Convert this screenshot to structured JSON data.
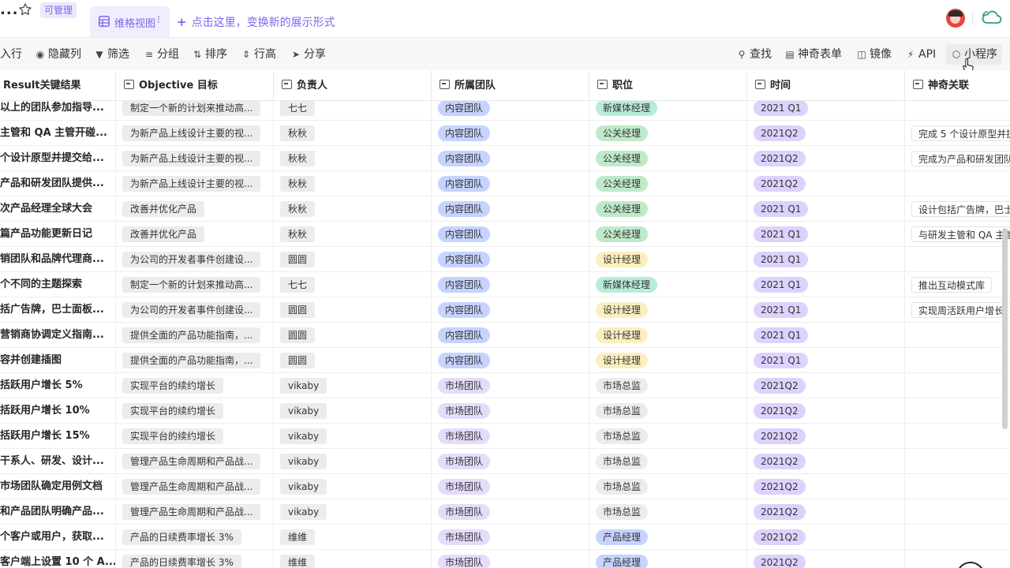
{
  "header": {
    "ellipsis": "...",
    "permission_badge": "可管理",
    "view_tab_label": "维格视图",
    "view_tab_more": "⁝",
    "add_view_plus": "+",
    "add_view_label": "点击这里，变换新的展示形式"
  },
  "toolbar": {
    "items": [
      {
        "label": "入行",
        "icon": ""
      },
      {
        "label": "隐藏列",
        "icon": "eye-icon"
      },
      {
        "label": "筛选",
        "icon": "filter-icon"
      },
      {
        "label": "分组",
        "icon": "group-icon"
      },
      {
        "label": "排序",
        "icon": "sort-icon"
      },
      {
        "label": "行高",
        "icon": "row-height-icon"
      },
      {
        "label": "分享",
        "icon": "share-icon"
      },
      {
        "label": "查找",
        "icon": "search-icon"
      },
      {
        "label": "神奇表单",
        "icon": "form-icon"
      },
      {
        "label": "镜像",
        "icon": "mirror-icon"
      },
      {
        "label": "API",
        "icon": "api-icon"
      },
      {
        "label": "小程序",
        "icon": "widget-icon"
      }
    ]
  },
  "columns": [
    {
      "label": "Result关键结果",
      "icon": "none"
    },
    {
      "label": "Objective 目标",
      "icon": "link-icon"
    },
    {
      "label": "负责人",
      "icon": "field-icon"
    },
    {
      "label": "所属团队",
      "icon": "field-icon"
    },
    {
      "label": "职位",
      "icon": "field-icon"
    },
    {
      "label": "时间",
      "icon": "field-icon"
    },
    {
      "label": "神奇关联",
      "icon": "link-icon"
    }
  ],
  "colors": {
    "accent": "#7b67ee",
    "team_inner": "#c6d3ff",
    "team_market": "#e5dcfb",
    "role_pr": "#bfeac9",
    "role_design": "#fbefbf",
    "role_media": "#b9ecd8",
    "role_market": "#ececec",
    "role_product": "#c6d3ff",
    "time": "#ddd2fd"
  },
  "rows": [
    {
      "kr": "以上的团队参加指导...",
      "objective": "制定一个新的计划来推动高...",
      "owner": "七七",
      "team": "内容团队",
      "team_c": "blue",
      "role": "新媒体经理",
      "role_c": "teal",
      "time": "2021 Q1",
      "link": "",
      "link2": ""
    },
    {
      "kr": "主管和 QA 主管开碰...",
      "objective": "为新产品上线设计主要的视...",
      "owner": "秋秋",
      "team": "内容团队",
      "team_c": "blue",
      "role": "公关经理",
      "role_c": "green",
      "time": "2021Q2",
      "link": "完成 5 个设计原型并提",
      "link2": ""
    },
    {
      "kr": "个设计原型并提交给...",
      "objective": "为新产品上线设计主要的视...",
      "owner": "秋秋",
      "team": "内容团队",
      "team_c": "blue",
      "role": "公关经理",
      "role_c": "green",
      "time": "2021Q2",
      "link": "完成为产品和研发团队",
      "link2": ""
    },
    {
      "kr": "产品和研发团队提供...",
      "objective": "为新产品上线设计主要的视...",
      "owner": "秋秋",
      "team": "内容团队",
      "team_c": "blue",
      "role": "公关经理",
      "role_c": "green",
      "time": "2021Q2",
      "link": "",
      "link2": ""
    },
    {
      "kr": "次产品经理全球大会",
      "objective": "改善并优化产品",
      "owner": "秋秋",
      "team": "内容团队",
      "team_c": "blue",
      "role": "公关经理",
      "role_c": "green",
      "time": "2021 Q1",
      "link": "设计包括广告牌，巴士",
      "link2": ""
    },
    {
      "kr": "篇产品功能更新日记",
      "objective": "改善并优化产品",
      "owner": "秋秋",
      "team": "内容团队",
      "team_c": "blue",
      "role": "公关经理",
      "role_c": "green",
      "time": "2021 Q1",
      "link": "与研发主管和 QA 主管",
      "link2": ""
    },
    {
      "kr": "销团队和品牌代理商...",
      "objective": "为公司的开发者事件创建设...",
      "owner": "圆圆",
      "team": "内容团队",
      "team_c": "blue",
      "role": "设计经理",
      "role_c": "yellow",
      "time": "2021 Q1",
      "link": "",
      "link2": ""
    },
    {
      "kr": "个不同的主题探索",
      "objective": "制定一个新的计划来推动高...",
      "owner": "七七",
      "team": "内容团队",
      "team_c": "blue",
      "role": "新媒体经理",
      "role_c": "teal",
      "time": "2021 Q1",
      "link": "推出互动模式库",
      "link2": " "
    },
    {
      "kr": "括广告牌，巴士面板...",
      "objective": "为公司的开发者事件创建设...",
      "owner": "圆圆",
      "team": "内容团队",
      "team_c": "blue",
      "role": "设计经理",
      "role_c": "yellow",
      "time": "2021 Q1",
      "link": "实现周活跃用户增长",
      "link2": ""
    },
    {
      "kr": "营销商协调定义指南...",
      "objective": "提供全面的产品功能指南，...",
      "owner": "圆圆",
      "team": "内容团队",
      "team_c": "blue",
      "role": "设计经理",
      "role_c": "yellow",
      "time": "2021 Q1",
      "link": "",
      "link2": ""
    },
    {
      "kr": "容并创建插图",
      "objective": "提供全面的产品功能指南，...",
      "owner": "圆圆",
      "team": "内容团队",
      "team_c": "blue",
      "role": "设计经理",
      "role_c": "yellow",
      "time": "2021 Q1",
      "link": "",
      "link2": ""
    },
    {
      "kr": "括跃用户增长 5%",
      "objective": "实现平台的续约增长",
      "owner": "vikaby",
      "team": "市场团队",
      "team_c": "lav",
      "role": "市场总监",
      "role_c": "gray",
      "time": "2021Q2",
      "link": "",
      "link2": ""
    },
    {
      "kr": "括跃用户增长 10%",
      "objective": "实现平台的续约增长",
      "owner": "vikaby",
      "team": "市场团队",
      "team_c": "lav",
      "role": "市场总监",
      "role_c": "gray",
      "time": "2021Q2",
      "link": "",
      "link2": ""
    },
    {
      "kr": "括跃用户增长 15%",
      "objective": "实现平台的续约增长",
      "owner": "vikaby",
      "team": "市场团队",
      "team_c": "lav",
      "role": "市场总监",
      "role_c": "gray",
      "time": "2021Q2",
      "link": "",
      "link2": ""
    },
    {
      "kr": "干系人、研发、设计...",
      "objective": "管理产品生命周期和产品战...",
      "owner": "vikaby",
      "team": "市场团队",
      "team_c": "lav",
      "role": "市场总监",
      "role_c": "gray",
      "time": "2021Q2",
      "link": "",
      "link2": ""
    },
    {
      "kr": "市场团队确定用例文档",
      "objective": "管理产品生命周期和产品战...",
      "owner": "vikaby",
      "team": "市场团队",
      "team_c": "lav",
      "role": "市场总监",
      "role_c": "gray",
      "time": "2021Q2",
      "link": "",
      "link2": ""
    },
    {
      "kr": "和产品团队明确产品...",
      "objective": "管理产品生命周期和产品战...",
      "owner": "vikaby",
      "team": "市场团队",
      "team_c": "lav",
      "role": "市场总监",
      "role_c": "gray",
      "time": "2021Q2",
      "link": "",
      "link2": ""
    },
    {
      "kr": "个客户或用户，获取...",
      "objective": "产品的日续费率增长 3%",
      "owner": "维维",
      "team": "市场团队",
      "team_c": "lav",
      "role": "产品经理",
      "role_c": "blue",
      "time": "2021Q2",
      "link": "",
      "link2": ""
    },
    {
      "kr": "客户端上设置 10 个 A...",
      "objective": "产品的日续费率增长 3%",
      "owner": "维维",
      "team": "市场团队",
      "team_c": "lav",
      "role": "产品经理",
      "role_c": "blue",
      "time": "2021Q2",
      "link": "",
      "link2": ""
    }
  ]
}
